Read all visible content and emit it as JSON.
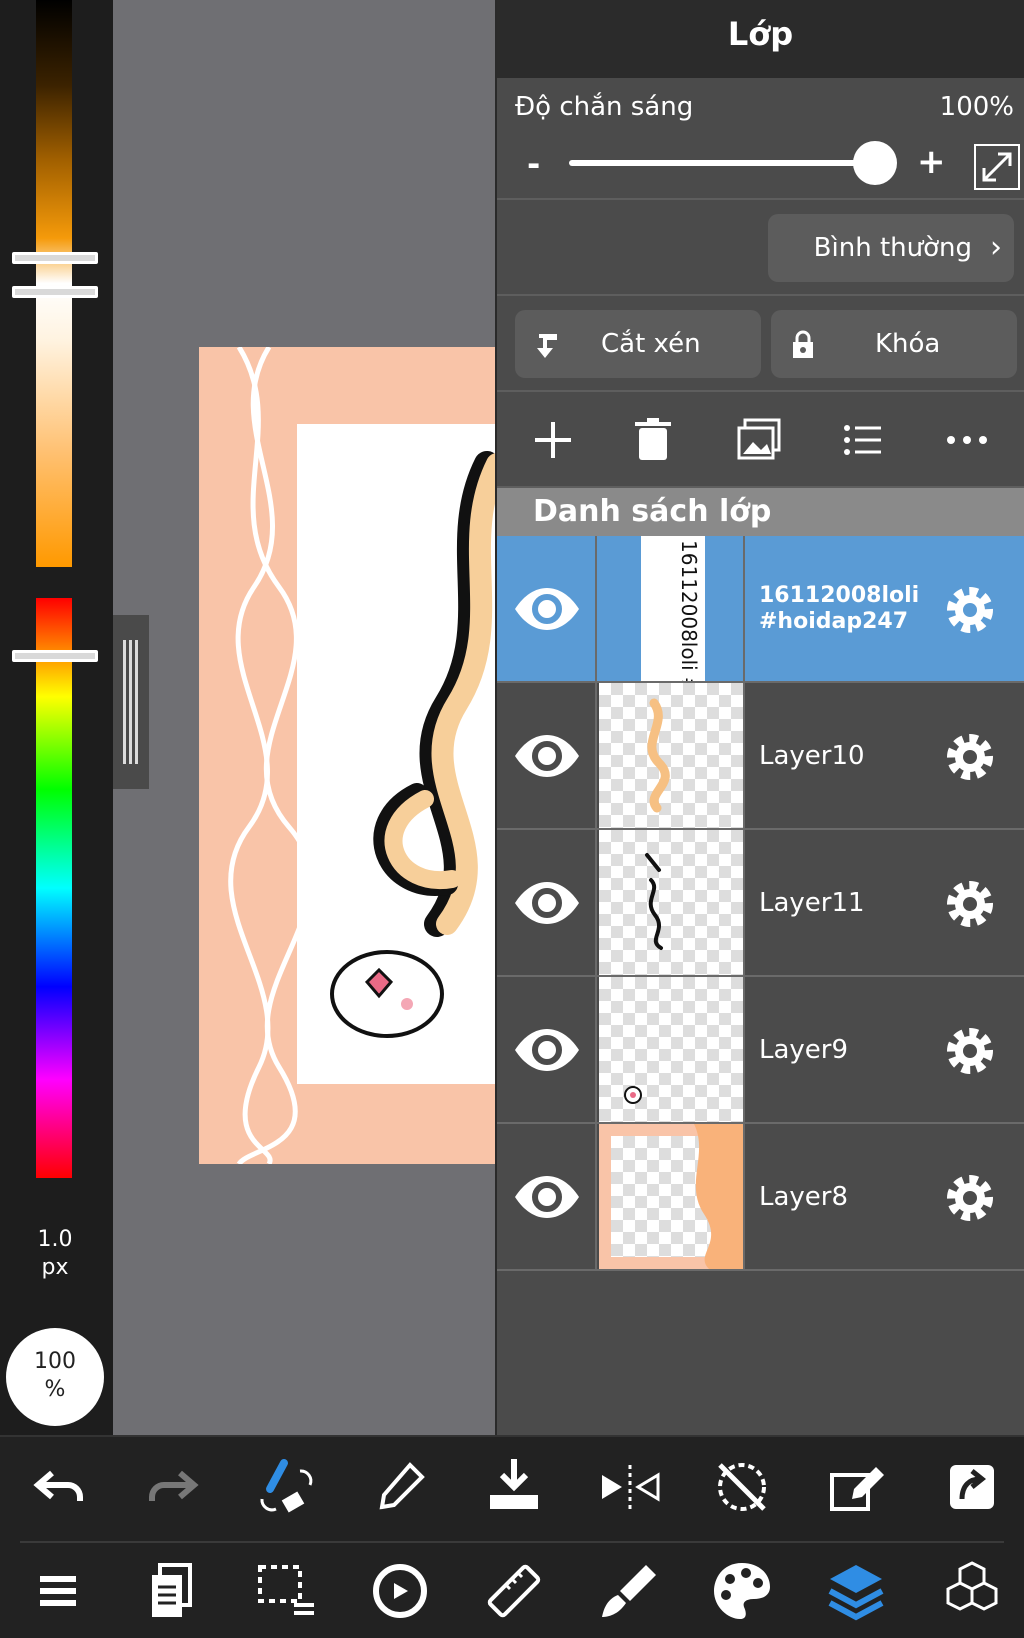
{
  "left_panel": {
    "brush_size_value": "1.0",
    "brush_size_unit": "px",
    "zoom_value": "100",
    "zoom_unit": "%"
  },
  "layer_panel": {
    "title": "Lớp",
    "opacity": {
      "label": "Độ chắn sáng",
      "value": "100%",
      "minus": "-",
      "plus": "+",
      "slider_fraction": 1.0
    },
    "blend_mode": "Bình thường",
    "clip_label": "Cắt xén",
    "lock_label": "Khóa",
    "tools": [
      "add-icon",
      "trash-icon",
      "image-icon",
      "list-icon",
      "more-icon"
    ],
    "list_header": "Danh sách lớp",
    "layers": [
      {
        "name": "16112008loli\n#hoidap247",
        "thumb_text": "16112008loli #hoidap247",
        "selected": true
      },
      {
        "name": "Layer10",
        "selected": false
      },
      {
        "name": "Layer11",
        "selected": false
      },
      {
        "name": "Layer9",
        "selected": false
      },
      {
        "name": "Layer8",
        "selected": false
      }
    ]
  },
  "bottom_toolbar_top": [
    "undo-icon",
    "redo-icon",
    "brush-eraser-icon",
    "eyedropper-icon",
    "download-icon",
    "flip-icon",
    "no-rotate-icon",
    "edit-icon",
    "share-icon"
  ],
  "bottom_toolbar_bottom": [
    "menu-icon",
    "pages-icon",
    "selection-icon",
    "transform-icon",
    "ruler-icon",
    "brush-icon",
    "palette-icon",
    "layers-icon",
    "materials-icon"
  ],
  "colors": {
    "accent": "#5a9bd5",
    "panel": "#4b4b4b",
    "artwork_bg": "#f9c4a8"
  }
}
